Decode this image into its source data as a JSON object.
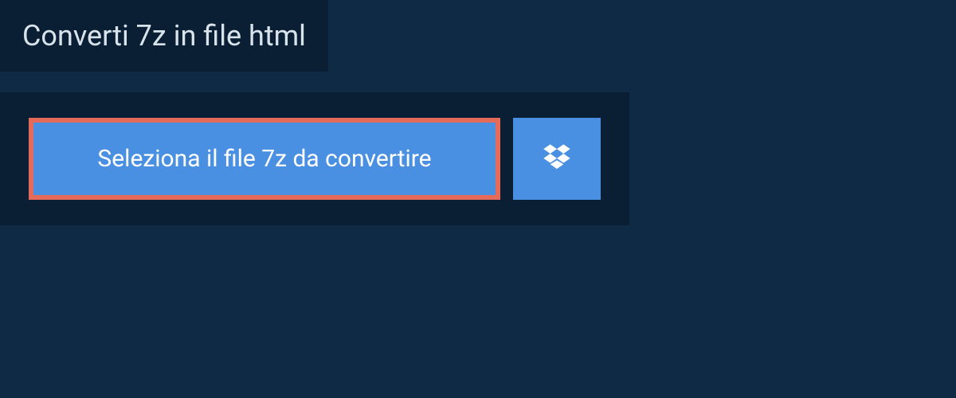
{
  "header": {
    "title": "Converti 7z in file html"
  },
  "upload": {
    "select_label": "Seleziona il file 7z da convertire"
  },
  "colors": {
    "page_bg": "#0f2a44",
    "panel_bg": "#0a1f33",
    "button_bg": "#4a90e2",
    "highlight_border": "#e46a5a",
    "text": "#d8e3ec",
    "button_text": "#ffffff"
  }
}
